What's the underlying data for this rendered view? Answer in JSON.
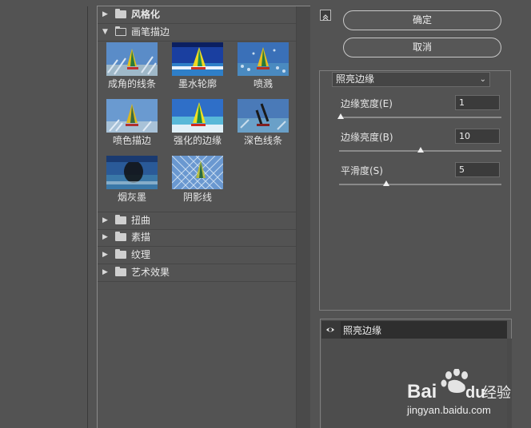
{
  "gallery": {
    "categories": [
      {
        "label": "风格化",
        "expanded": false
      },
      {
        "label": "画笔描边",
        "expanded": true
      },
      {
        "label": "扭曲",
        "expanded": false
      },
      {
        "label": "素描",
        "expanded": false
      },
      {
        "label": "纹理",
        "expanded": false
      },
      {
        "label": "艺术效果",
        "expanded": false
      }
    ],
    "thumbnails": [
      {
        "label": "成角的线条"
      },
      {
        "label": "墨水轮廓"
      },
      {
        "label": "喷溅"
      },
      {
        "label": "喷色描边"
      },
      {
        "label": "强化的边缘"
      },
      {
        "label": "深色线条"
      },
      {
        "label": "烟灰墨"
      },
      {
        "label": "阴影线"
      }
    ]
  },
  "buttons": {
    "ok": "确定",
    "cancel": "取消"
  },
  "filter": {
    "selected": "照亮边缘"
  },
  "params": [
    {
      "label": "边缘宽度(E)",
      "value": "1",
      "slider": 0.0
    },
    {
      "label": "边缘亮度(B)",
      "value": "10",
      "slider": 0.5
    },
    {
      "label": "平滑度(S)",
      "value": "5",
      "slider": 0.28
    }
  ],
  "layers": [
    {
      "label": "照亮边缘",
      "visible": true
    }
  ],
  "watermark": {
    "brand": "Bai",
    "brand2": "du",
    "text": "经验",
    "url": "jingyan.baidu.com"
  }
}
